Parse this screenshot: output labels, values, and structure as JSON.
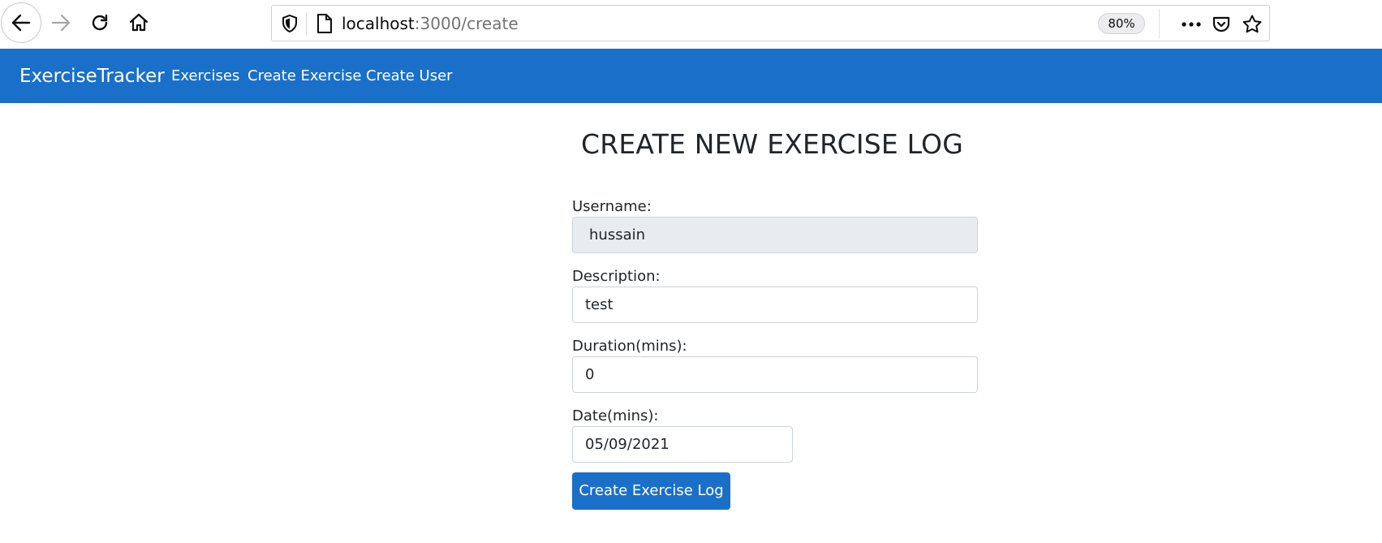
{
  "browser": {
    "url_host": "localhost",
    "url_path": ":3000/create",
    "zoom": "80%",
    "icons": [
      "back-arrow-icon",
      "forward-arrow-icon",
      "reload-icon",
      "home-icon",
      "shield-icon",
      "page-icon",
      "more-icon",
      "pocket-icon",
      "star-icon"
    ]
  },
  "navbar": {
    "brand": "ExerciseTracker",
    "links": [
      "Exercises",
      "Create Exercise",
      "Create User"
    ],
    "color": "#1a70c8"
  },
  "page": {
    "title": "CREATE NEW EXERCISE LOG"
  },
  "form": {
    "username_label": "Username:",
    "username_value": "hussain",
    "description_label": "Description:",
    "description_value": "test",
    "duration_label": "Duration(mins):",
    "duration_value": "0",
    "date_label": "Date(mins):",
    "date_value": "05/09/2021",
    "submit_label": "Create Exercise Log"
  }
}
